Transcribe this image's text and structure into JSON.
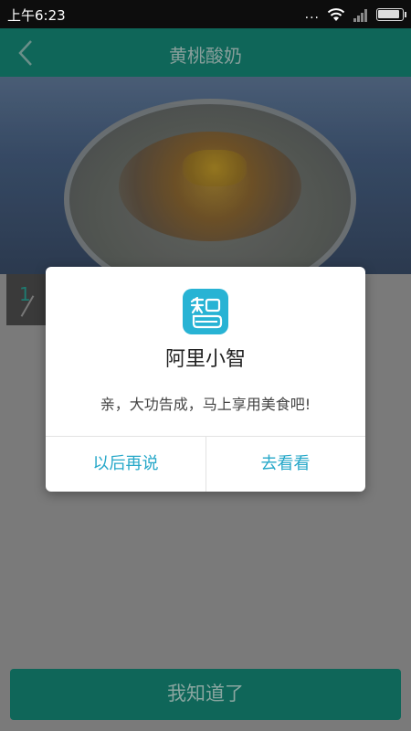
{
  "status_bar": {
    "time": "上午6:23",
    "more": "...",
    "battery": "full"
  },
  "header": {
    "title": "黄桃酸奶",
    "back_icon": "chevron-left-icon"
  },
  "hero": {
    "image": "yellow-peach-yogurt-photo",
    "counter": "1"
  },
  "dialog": {
    "app_icon": "zhi-icon",
    "app_name": "阿里小智",
    "message": "亲，大功告成，马上享用美食吧!",
    "btn_later": "以后再说",
    "btn_view": "去看看",
    "accent_color": "#27a8c9"
  },
  "footer": {
    "confirm": "我知道了"
  },
  "colors": {
    "header_bg": "#0f6659",
    "overlay": "#7a7a7a"
  }
}
